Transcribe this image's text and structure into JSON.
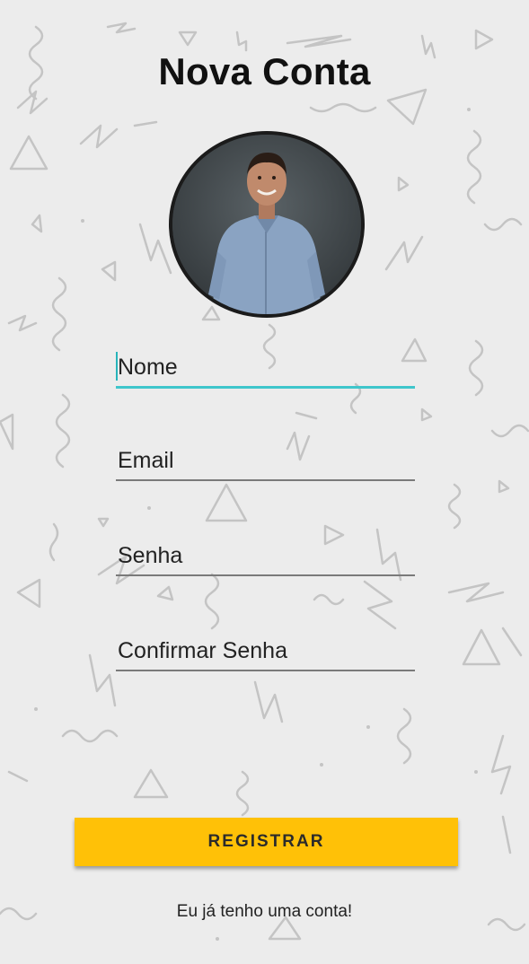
{
  "header": {
    "title": "Nova Conta"
  },
  "avatar": {
    "icon": "profile-photo"
  },
  "form": {
    "fields": [
      {
        "label": "Nome",
        "focused": true
      },
      {
        "label": "Email",
        "focused": false
      },
      {
        "label": "Senha",
        "focused": false
      },
      {
        "label": "Confirmar Senha",
        "focused": false
      }
    ]
  },
  "actions": {
    "register_label": "REGISTRAR",
    "login_link": "Eu já tenho uma conta!"
  },
  "colors": {
    "accent": "#3fc6cb",
    "button": "#ffc107",
    "background": "#ececec"
  }
}
